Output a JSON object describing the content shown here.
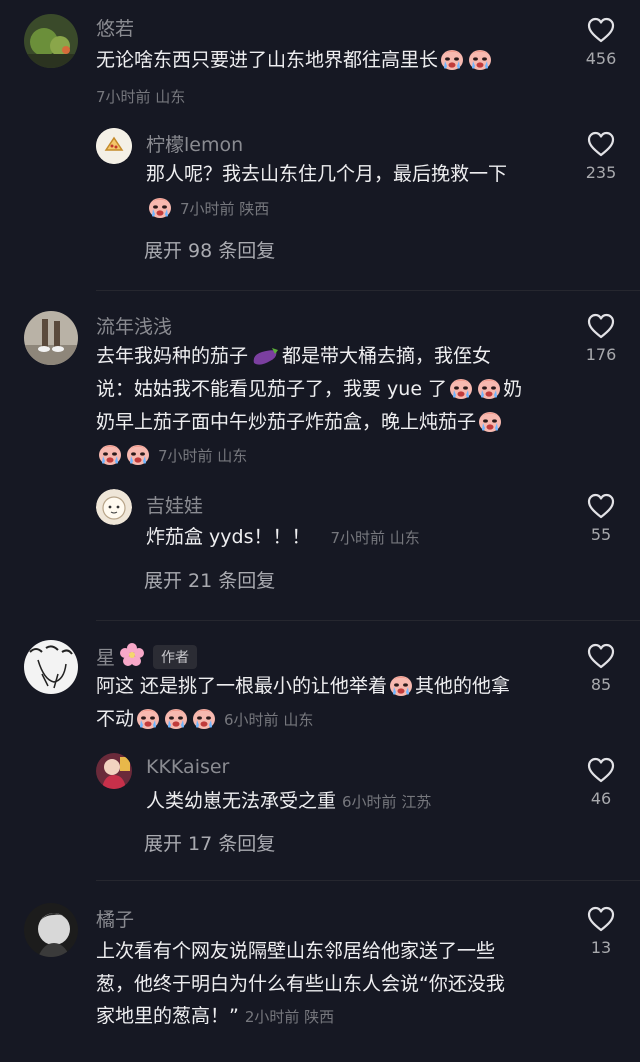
{
  "comments": [
    {
      "username": "悠若",
      "text": "无论啥东西只要进了山东地界都往高里长",
      "meta": "7小时前 山东",
      "likes": "456",
      "reply": {
        "username": "柠檬lemon",
        "text_line1": "那人呢？我去山东住几个月，最后挽救一下",
        "meta": "7小时前 陕西",
        "likes": "235"
      },
      "expand": "展开 98 条回复"
    },
    {
      "username": "流年浅浅",
      "text_part1": "去年我妈种的茄子",
      "text_part2": "都是带大桶去摘，我侄女",
      "text_line2a": "说：姑姑我不能看见茄子了，我要 yue 了",
      "text_line2b": "奶",
      "text_line3": "奶早上茄子面中午炒茄子炸茄盒，晚上炖茄子",
      "meta": "7小时前 山东",
      "likes": "176",
      "reply": {
        "username": "吉娃娃",
        "text": "炸茄盒 yyds！！！",
        "meta": "7小时前 山东",
        "likes": "55"
      },
      "expand": "展开 21 条回复"
    },
    {
      "username": "星",
      "author_tag": "作者",
      "text_line1a": "阿这 还是挑了一根最小的让他举着",
      "text_line1b": "其他的他拿",
      "text_line2": "不动",
      "meta": "6小时前 山东",
      "likes": "85",
      "reply": {
        "username": "KKKaiser",
        "text": "人类幼崽无法承受之重",
        "meta": "6小时前 江苏",
        "likes": "46"
      },
      "expand": "展开 17 条回复"
    },
    {
      "username": "橘子",
      "text_line1": "上次看有个网友说隔壁山东邻居给他家送了一些",
      "text_line2": "葱，他终于明白为什么有些山东人会说“你还没我",
      "text_line3": "家地里的葱高！”",
      "meta": "2小时前 陕西",
      "likes": "13"
    }
  ],
  "icons": {
    "like": "heart-outline-icon",
    "emoji": "crying-face-emoji",
    "flower": "cherry-blossom-emoji",
    "eggplant": "eggplant-emoji"
  }
}
